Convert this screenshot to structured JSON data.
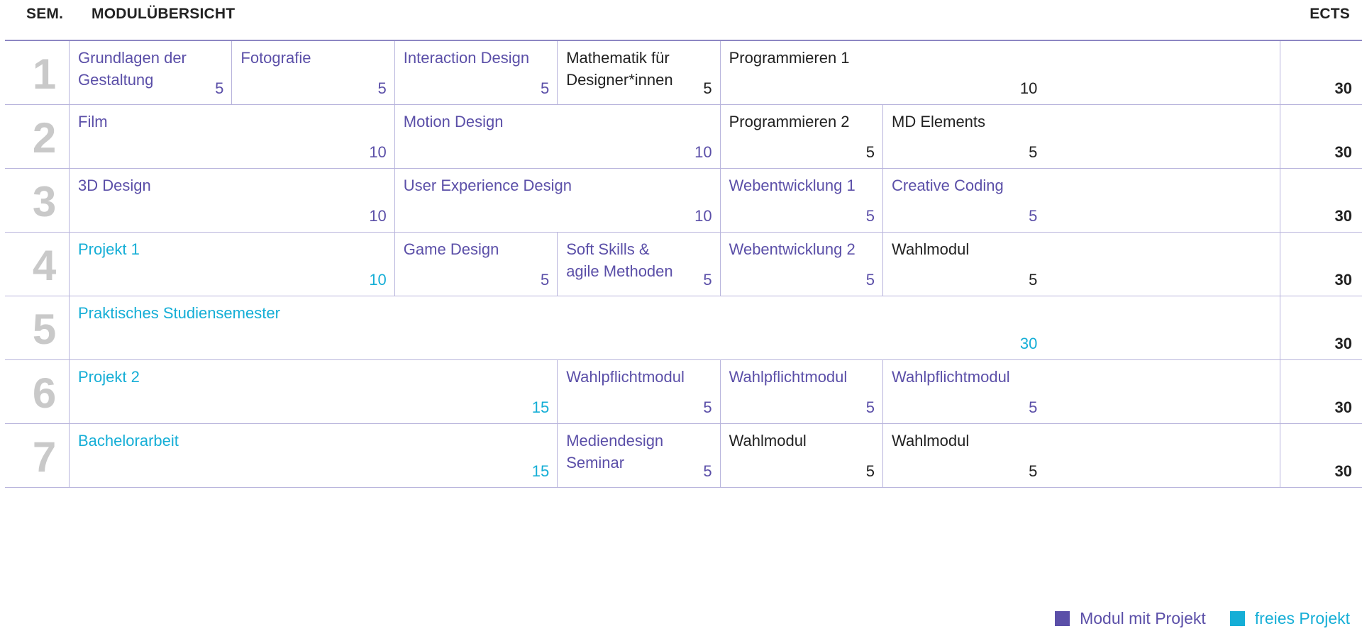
{
  "header": {
    "sem_label": "SEM.",
    "modules_label": "MODULÜBERSICHT",
    "ects_label": "ECTS"
  },
  "colors": {
    "modul_mit_projekt": "#5b4fa8",
    "freies_projekt": "#15aed6",
    "plain": "#222222",
    "semester_number": "#c9c9c9",
    "grid_line": "#b8b4dc"
  },
  "semesters": [
    {
      "number": "1",
      "total": "30",
      "modules": [
        {
          "name": "Grundlagen der\nGestaltung",
          "ects": "5",
          "type": "project"
        },
        {
          "name": "Fotografie",
          "ects": "5",
          "type": "project"
        },
        {
          "name": "Interaction Design",
          "ects": "5",
          "type": "project"
        },
        {
          "name": "Mathematik für\nDesigner*innen",
          "ects": "5",
          "type": "plain"
        },
        {
          "name": "Programmieren 1",
          "ects": "10",
          "type": "plain"
        }
      ]
    },
    {
      "number": "2",
      "total": "30",
      "modules": [
        {
          "name": "Film",
          "ects": "10",
          "type": "project"
        },
        {
          "name": "Motion Design",
          "ects": "10",
          "type": "project"
        },
        {
          "name": "Programmieren 2",
          "ects": "5",
          "type": "plain"
        },
        {
          "name": "MD Elements",
          "ects": "5",
          "type": "plain"
        }
      ]
    },
    {
      "number": "3",
      "total": "30",
      "modules": [
        {
          "name": "3D Design",
          "ects": "10",
          "type": "project"
        },
        {
          "name": "User Experience Design",
          "ects": "10",
          "type": "project"
        },
        {
          "name": "Webentwicklung 1",
          "ects": "5",
          "type": "project"
        },
        {
          "name": "Creative Coding",
          "ects": "5",
          "type": "project"
        }
      ]
    },
    {
      "number": "4",
      "total": "30",
      "modules": [
        {
          "name": "Projekt 1",
          "ects": "10",
          "type": "free"
        },
        {
          "name": "Game Design",
          "ects": "5",
          "type": "project"
        },
        {
          "name": "Soft Skills &\nagile Methoden",
          "ects": "5",
          "type": "project"
        },
        {
          "name": "Webentwicklung 2",
          "ects": "5",
          "type": "project"
        },
        {
          "name": "Wahlmodul",
          "ects": "5",
          "type": "plain"
        }
      ]
    },
    {
      "number": "5",
      "total": "30",
      "modules": [
        {
          "name": "Praktisches Studiensemester",
          "ects": "30",
          "type": "free"
        }
      ]
    },
    {
      "number": "6",
      "total": "30",
      "modules": [
        {
          "name": "Projekt 2",
          "ects": "15",
          "type": "free"
        },
        {
          "name": "Wahlpflichtmodul",
          "ects": "5",
          "type": "project"
        },
        {
          "name": "Wahlpflichtmodul",
          "ects": "5",
          "type": "project"
        },
        {
          "name": "Wahlpflichtmodul",
          "ects": "5",
          "type": "project"
        }
      ]
    },
    {
      "number": "7",
      "total": "30",
      "modules": [
        {
          "name": "Bachelorarbeit",
          "ects": "15",
          "type": "free"
        },
        {
          "name": "Mediendesign Seminar",
          "ects": "5",
          "type": "project"
        },
        {
          "name": "Wahlmodul",
          "ects": "5",
          "type": "plain"
        },
        {
          "name": "Wahlmodul",
          "ects": "5",
          "type": "plain"
        }
      ]
    }
  ],
  "legend": {
    "project_label": "Modul mit Projekt",
    "free_label": "freies Projekt"
  }
}
